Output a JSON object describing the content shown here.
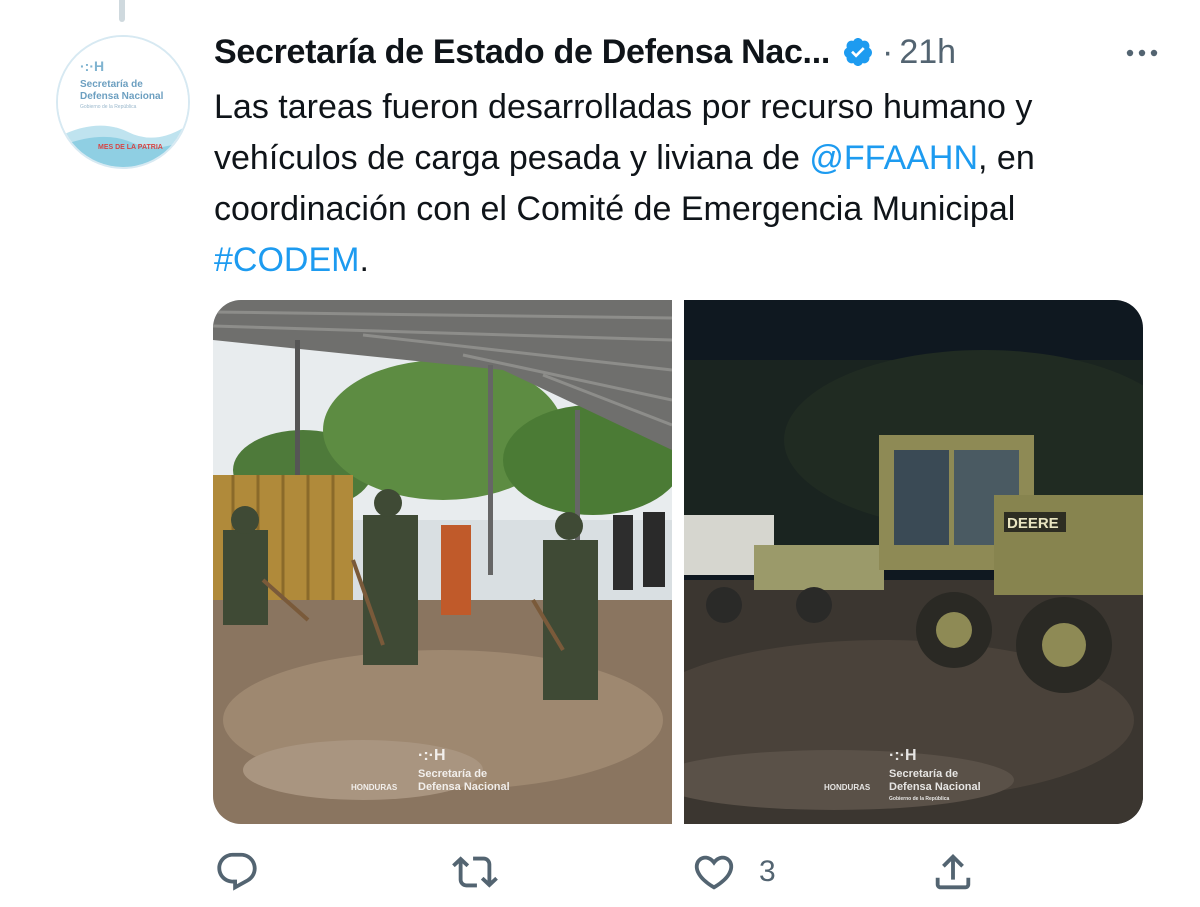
{
  "author": {
    "name": "Secretaría de Estado de Defensa Nac...",
    "time": "21h",
    "separator": "·",
    "verified_icon": "verified-badge-icon",
    "avatar": {
      "org": "Secretaría de",
      "org2": "Defensa Nacional",
      "gov": "Gobierno de la República",
      "motto": "MES DE LA PATRIA"
    }
  },
  "tweet": {
    "text_1": "Las tareas fueron desarrolladas por recurso humano y vehículos de carga pesada y liviana de ",
    "mention": "@FFAAHN",
    "text_2": ", en coordinación con el Comité de Emergencia Municipal ",
    "hashtag": "#CODEM",
    "text_3": "."
  },
  "media": {
    "watermark_left": "HONDURAS",
    "watermark_org": "Secretaría de",
    "watermark_org2": "Defensa Nacional",
    "watermark_gov": "Gobierno de la República",
    "vehicle_brand": "DEERE"
  },
  "actions": {
    "reply_count": "",
    "retweet_count": "",
    "like_count": "3",
    "share_count": ""
  },
  "colors": {
    "accent": "#1d9bf0",
    "secondary_text": "#536471",
    "primary_text": "#0f1419"
  }
}
